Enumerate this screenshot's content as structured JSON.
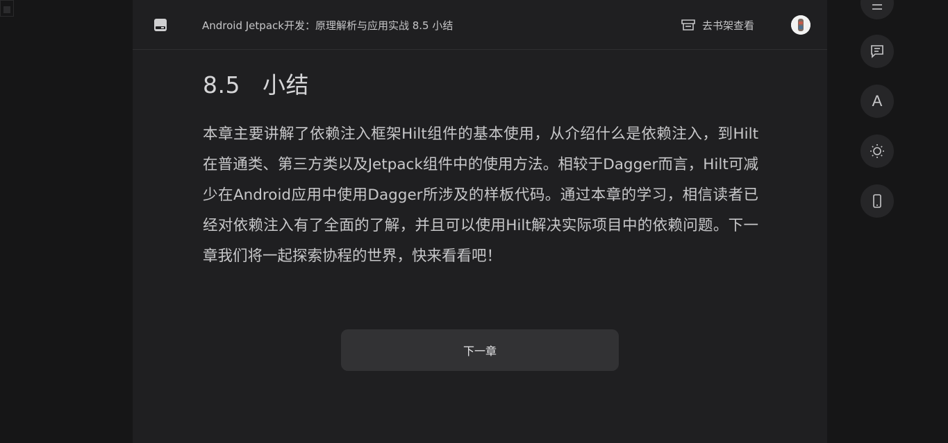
{
  "header": {
    "book_title": "Android Jetpack开发：原理解析与应用实战 8.5 小结",
    "shelf_label": "去书架查看"
  },
  "chapter": {
    "number": "8.5",
    "title": "小结",
    "body": "本章主要讲解了依赖注入框架Hilt组件的基本使用，从介绍什么是依赖注入，到Hilt在普通类、第三方类以及Jetpack组件中的使用方法。相较于Dagger而言，Hilt可减少在Android应用中使用Dagger所涉及的样板代码。通过本章的学习，相信读者已经对依赖注入有了全面的了解，并且可以使用Hilt解决实际项目中的依赖问题。下一章我们将一起探索协程的世界，快来看看吧！"
  },
  "footer": {
    "next_chapter_label": "下一章"
  },
  "side_toolbar": {
    "font_label": "A",
    "icons": [
      "menu-icon",
      "comment-icon",
      "font-icon",
      "brightness-icon",
      "phone-icon"
    ]
  },
  "colors": {
    "page_bg": "#161617",
    "reader_bg": "#1f1f21",
    "button_bg": "#323234",
    "text": "#c8c8ca"
  }
}
